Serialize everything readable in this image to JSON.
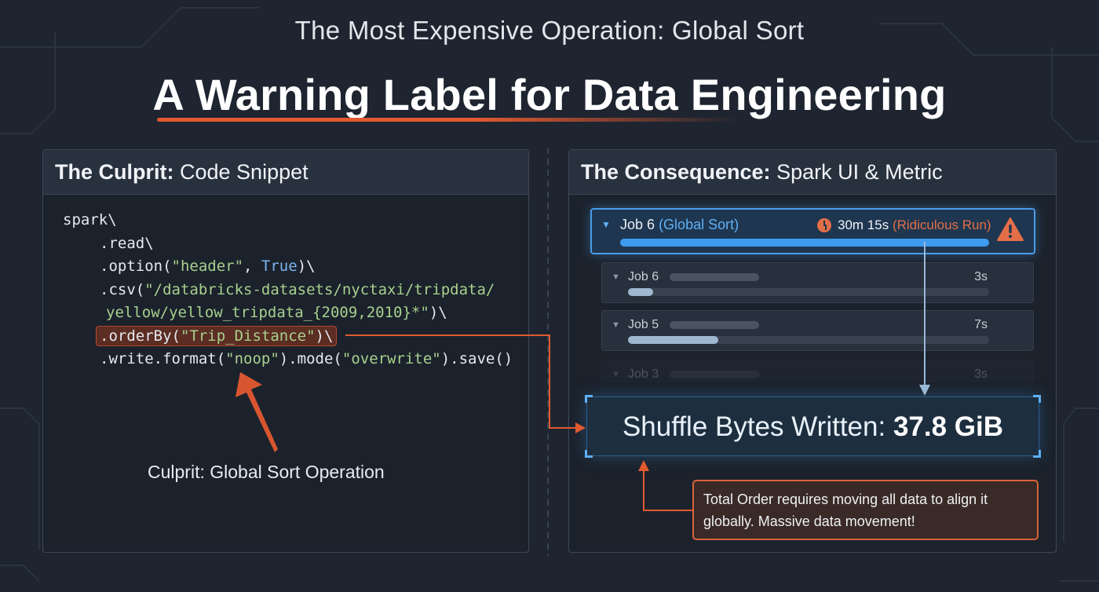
{
  "kicker": "The Most Expensive Operation: Global Sort",
  "headline": "A Warning Label for Data Engineering",
  "colors": {
    "accent_orange": "#e2592f",
    "accent_blue": "#4a9be6",
    "background": "#1e2530"
  },
  "left_panel": {
    "title_bold": "The Culprit:",
    "title_rest": "Code Snippet",
    "code": {
      "line1": "spark\\",
      "line2": ".read\\",
      "line3_prefix": ".option(",
      "line3_string": "\"header\"",
      "line3_mid": ", ",
      "line3_keyword": "True",
      "line3_suffix": ")\\",
      "line4_prefix": ".csv(",
      "line4_string": "\"/databricks-datasets/nyctaxi/tripdata/",
      "line5_string": "yellow/yellow_tripdata_{2009,2010}*\"",
      "line5_suffix": ")\\",
      "line6_prefix": ".orderBy(",
      "line6_string": "\"Trip_Distance\"",
      "line6_suffix": ")\\",
      "line7_prefix": ".write.format(",
      "line7_string1": "\"noop\"",
      "line7_mid": ").mode(",
      "line7_string2": "\"overwrite\"",
      "line7_suffix": ").save()"
    },
    "culprit_label": "Culprit: Global Sort Operation"
  },
  "right_panel": {
    "title_bold": "The Consequence:",
    "title_rest": "Spark UI & Metric",
    "main_job": {
      "name": "Job 6",
      "tag": "(Global Sort)",
      "duration": "30m 15s",
      "duration_note": "(Ridiculous Run)",
      "icon": "warning-triangle-icon",
      "progress": 1.0
    },
    "jobs": [
      {
        "name": "Job 6",
        "duration": "3s",
        "progress": 0.07
      },
      {
        "name": "Job 5",
        "duration": "7s",
        "progress": 0.25
      },
      {
        "name": "Job 3",
        "duration": "3s",
        "progress": 0.1
      }
    ],
    "metric_label": "Shuffle Bytes Written:",
    "metric_value": "37.8 GiB",
    "note": "Total Order requires moving all data to align it globally. Massive data movement!"
  }
}
